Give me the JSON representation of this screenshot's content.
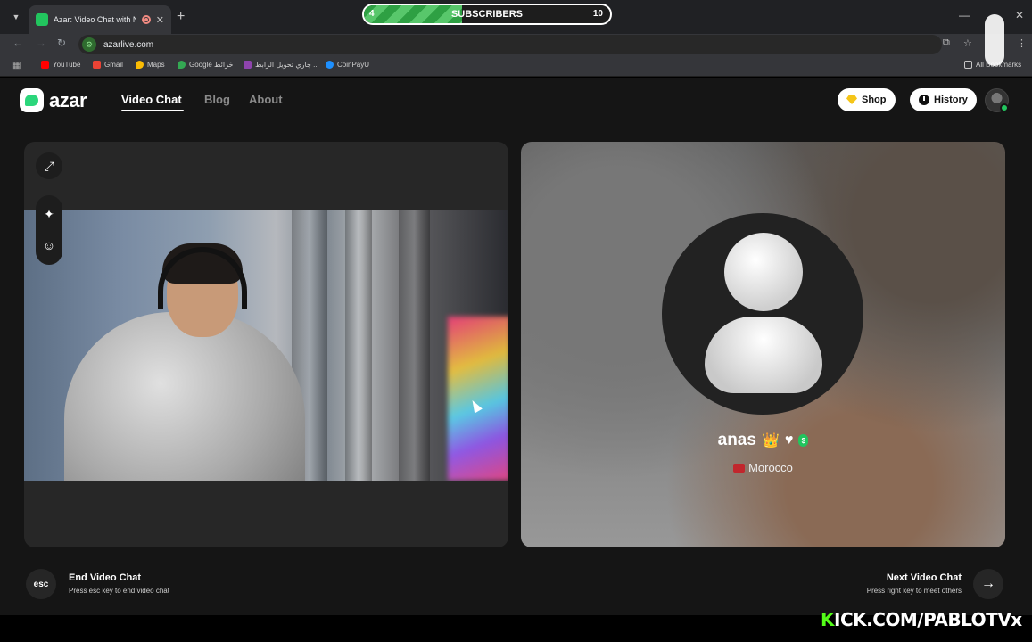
{
  "browser": {
    "tab_title": "Azar: Video Chat with New",
    "url": "azarlive.com",
    "bookmarks": [
      {
        "label": "YouTube",
        "color": "#ff0000"
      },
      {
        "label": "Gmail",
        "color": "#ea4335"
      },
      {
        "label": "Maps",
        "color": "#fbbc04"
      },
      {
        "label": "Google خرائط",
        "color": "#34a853"
      },
      {
        "label": "جاري تحويل الرابط ...",
        "color": "#8e44ad"
      },
      {
        "label": "CoinPayU",
        "color": "#1e90ff"
      }
    ],
    "all_bookmarks": "All Bookmarks"
  },
  "overlay": {
    "label": "SUBSCRIBERS",
    "current": "4",
    "goal": "10",
    "progress": 0.4
  },
  "nav": {
    "logo": "azar",
    "links": [
      "Video Chat",
      "Blog",
      "About"
    ],
    "shop": "Shop",
    "history": "History"
  },
  "peer": {
    "name": "anas",
    "country": "Morocco"
  },
  "controls": {
    "end_key": "esc",
    "end_title": "End Video Chat",
    "end_sub": "Press esc key to end video chat",
    "next_title": "Next Video Chat",
    "next_sub": "Press right key to meet others"
  },
  "watermark": {
    "k": "K",
    "rest": "ICK.COM/PABLOTVx"
  }
}
